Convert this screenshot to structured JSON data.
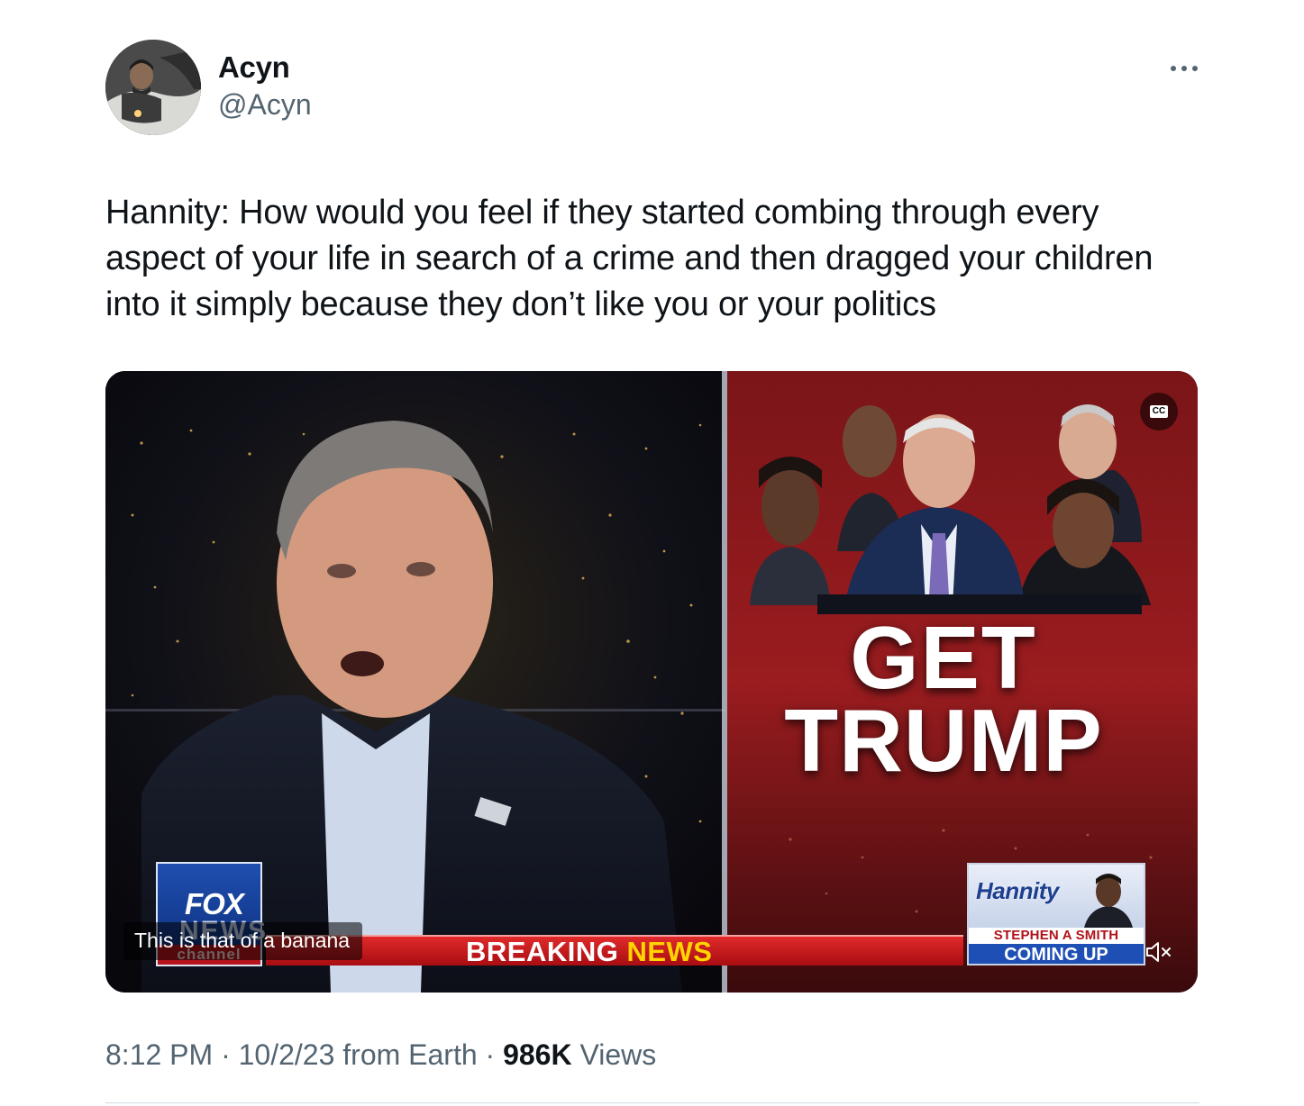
{
  "author": {
    "display_name": "Acyn",
    "handle": "@Acyn",
    "avatar": "profile-photo"
  },
  "more_options": {
    "icon": "more-horizontal-icon"
  },
  "tweet": {
    "text": "Hannity: How would you feel if they started combing through every\naspect of your life in search of a crime and then dragged your children\ninto it simply because they don’t like you or your politics"
  },
  "video": {
    "cc_label": "CC",
    "caption": "This is that of a banana",
    "overlay_line1": "GET",
    "overlay_line2": "TRUMP",
    "logo_fox": "FOX",
    "logo_news": "NEWS",
    "logo_channel": "channel",
    "ticker_breaking": "BREAKING",
    "ticker_news": "NEWS",
    "promo_show": "Hannity",
    "promo_guest": "STEPHEN A SMITH",
    "promo_coming": "COMING UP",
    "mute_icon": "volume-muted-icon"
  },
  "meta": {
    "time": "8:12 PM",
    "sep1": " · ",
    "date": "10/2/23",
    "source": " from Earth",
    "sep2": " · ",
    "views_count": "986K",
    "views_label": " Views"
  },
  "colors": {
    "text": "#0f1419",
    "secondary": "#536471",
    "divider": "#cfd9de",
    "fox_blue": "#1f4fb0",
    "breaking_red": "#c8161c",
    "news_yellow": "#ffd400"
  }
}
